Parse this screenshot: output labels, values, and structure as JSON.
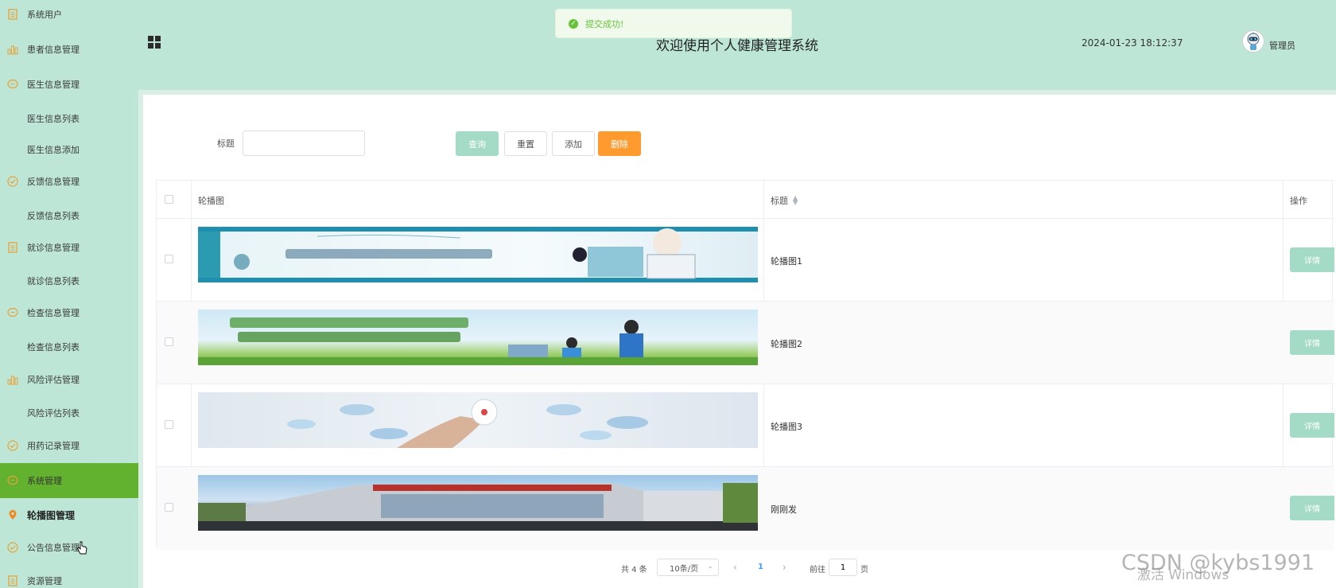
{
  "sidebar": {
    "items": [
      {
        "label": "系统用户",
        "icon": "doc-icon"
      },
      {
        "label": "患者信息管理",
        "icon": "bar-chart-icon"
      },
      {
        "label": "医生信息管理",
        "icon": "chat-icon"
      },
      {
        "label": "医生信息列表"
      },
      {
        "label": "医生信息添加"
      },
      {
        "label": "反馈信息管理",
        "icon": "check-circle-icon"
      },
      {
        "label": "反馈信息列表"
      },
      {
        "label": "就诊信息管理",
        "icon": "doc-icon"
      },
      {
        "label": "就诊信息列表"
      },
      {
        "label": "检查信息管理",
        "icon": "chat-icon"
      },
      {
        "label": "检查信息列表"
      },
      {
        "label": "风险评估管理",
        "icon": "bar-chart-icon"
      },
      {
        "label": "风险评估列表"
      },
      {
        "label": "用药记录管理",
        "icon": "check-circle-icon"
      },
      {
        "label": "系统管理",
        "icon": "chat-icon"
      },
      {
        "label": "轮播图管理",
        "icon": "location-pin-icon"
      },
      {
        "label": "公告信息管理",
        "icon": "check-circle-icon"
      },
      {
        "label": "资源管理",
        "icon": "doc-icon"
      }
    ]
  },
  "header": {
    "title": "欢迎使用个人健康管理系统",
    "datetime": "2024-01-23 18:12:37",
    "username": "管理员"
  },
  "toast": {
    "message": "提交成功!"
  },
  "search": {
    "label": "标题",
    "value": "",
    "query_label": "查询",
    "reset_label": "重置",
    "add_label": "添加",
    "delete_label": "删除"
  },
  "table": {
    "columns": {
      "image": "轮播图",
      "title": "标题",
      "actions": "操作"
    },
    "rows": [
      {
        "title": "轮播图1",
        "action": "详情"
      },
      {
        "title": "轮播图2",
        "action": "详情"
      },
      {
        "title": "轮播图3",
        "action": "详情"
      },
      {
        "title": "刚刚发",
        "action": "详情"
      }
    ]
  },
  "pagination": {
    "total": "共 4 条",
    "page_size": "10条/页",
    "current_page": "1",
    "goto_label": "前往",
    "goto_value": "1",
    "page_suffix": "页"
  },
  "watermark": {
    "activate": "激活 Windows",
    "csdn": "CSDN @kybs1991"
  },
  "colors": {
    "sidebar_bg": "#bde6d6",
    "active_item": "#63b22f",
    "primary_btn": "#a4dbc6",
    "danger_btn": "#ff9a2e",
    "toast_green": "#67c23a"
  }
}
